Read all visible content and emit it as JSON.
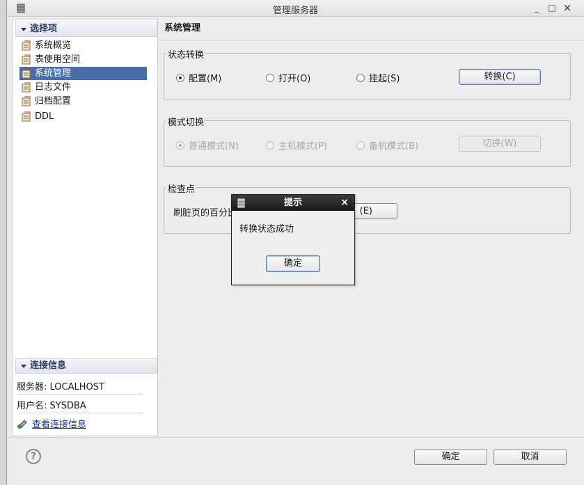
{
  "window": {
    "title": "管理服务器",
    "minimize": "_",
    "maximize": "□",
    "close": "×"
  },
  "sidebar": {
    "select_header": "选择项",
    "items": [
      {
        "label": "系统概览",
        "selected": false
      },
      {
        "label": "表使用空间",
        "selected": false
      },
      {
        "label": "系统管理",
        "selected": true
      },
      {
        "label": "日志文件",
        "selected": false
      },
      {
        "label": "归档配置",
        "selected": false
      },
      {
        "label": "DDL",
        "selected": false
      }
    ],
    "conn_header": "连接信息",
    "server": "服务器: LOCALHOST",
    "user": "用户名: SYSDBA",
    "view_link": "查看连接信息"
  },
  "main": {
    "title": "系统管理",
    "state_group": {
      "label": "状态转换",
      "options": [
        "配置(M)",
        "打开(O)",
        "挂起(S)"
      ],
      "selected": 0,
      "button": "转换(C)"
    },
    "mode_group": {
      "label": "模式切换",
      "options": [
        "普通模式(N)",
        "主机模式(P)",
        "备机模式(B)"
      ],
      "selected": 0,
      "button": "切换(W)"
    },
    "checkpoint_group": {
      "label": "检查点",
      "text": "刷脏页的百分比",
      "button_suffix": "(E)"
    }
  },
  "footer": {
    "help": "?",
    "ok": "确定",
    "cancel": "取消"
  },
  "dialog": {
    "title": "提示",
    "close": "×",
    "message": "转换状态成功",
    "ok": "确定"
  },
  "colors": {
    "selection": "#4a6ea9",
    "dialog_title": "#1a1a1a"
  }
}
